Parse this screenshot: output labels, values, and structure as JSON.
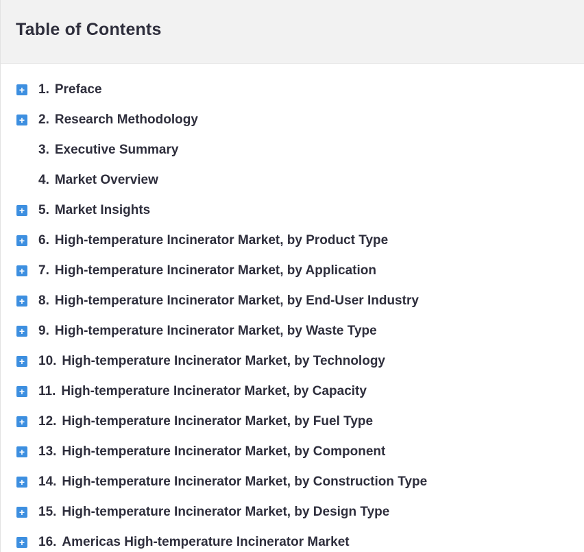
{
  "toc": {
    "title": "Table of Contents",
    "items": [
      {
        "num": "1.",
        "label": "Preface",
        "expandable": true
      },
      {
        "num": "2.",
        "label": "Research Methodology",
        "expandable": true
      },
      {
        "num": "3.",
        "label": "Executive Summary",
        "expandable": false
      },
      {
        "num": "4.",
        "label": "Market Overview",
        "expandable": false
      },
      {
        "num": "5.",
        "label": "Market Insights",
        "expandable": true
      },
      {
        "num": "6.",
        "label": "High-temperature Incinerator Market, by Product Type",
        "expandable": true
      },
      {
        "num": "7.",
        "label": "High-temperature Incinerator Market, by Application",
        "expandable": true
      },
      {
        "num": "8.",
        "label": "High-temperature Incinerator Market, by End-User Industry",
        "expandable": true
      },
      {
        "num": "9.",
        "label": "High-temperature Incinerator Market, by Waste Type",
        "expandable": true
      },
      {
        "num": "10.",
        "label": "High-temperature Incinerator Market, by Technology",
        "expandable": true
      },
      {
        "num": "11.",
        "label": "High-temperature Incinerator Market, by Capacity",
        "expandable": true
      },
      {
        "num": "12.",
        "label": "High-temperature Incinerator Market, by Fuel Type",
        "expandable": true
      },
      {
        "num": "13.",
        "label": "High-temperature Incinerator Market, by Component",
        "expandable": true
      },
      {
        "num": "14.",
        "label": "High-temperature Incinerator Market, by Construction Type",
        "expandable": true
      },
      {
        "num": "15.",
        "label": "High-temperature Incinerator Market, by Design Type",
        "expandable": true
      },
      {
        "num": "16.",
        "label": "Americas High-temperature Incinerator Market",
        "expandable": true
      }
    ],
    "expand_icon": "plus-square-icon",
    "expand_symbol": "+",
    "accent_color": "#3d8fe0"
  }
}
